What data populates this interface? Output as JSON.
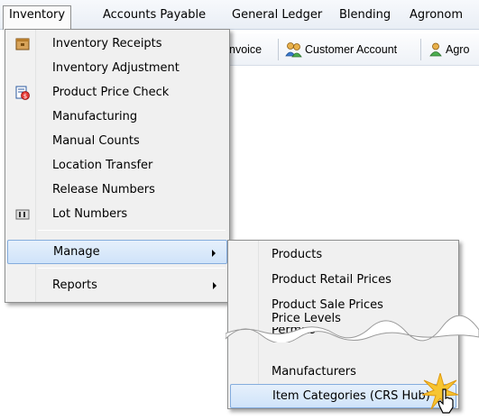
{
  "menubar": {
    "items": [
      {
        "label": "Inventory",
        "active": true
      },
      {
        "label": "Accounts Payable"
      },
      {
        "label": "General Ledger"
      },
      {
        "label": "Blending"
      },
      {
        "label": "Agronom"
      }
    ]
  },
  "toolbar": {
    "items": [
      {
        "label": "nvoice"
      },
      {
        "label": "Customer Account",
        "icon": "customers-icon"
      },
      {
        "label": "Agro",
        "icon": "person-icon"
      }
    ]
  },
  "menu": {
    "items": [
      {
        "label": "Inventory Receipts",
        "icon": "box-icon"
      },
      {
        "label": "Inventory Adjustment"
      },
      {
        "label": "Product Price Check",
        "icon": "price-check-icon"
      },
      {
        "label": "Manufacturing"
      },
      {
        "label": "Manual Counts"
      },
      {
        "label": "Location Transfer"
      },
      {
        "label": "Release Numbers"
      },
      {
        "label": "Lot Numbers",
        "icon": "lot-icon"
      },
      {
        "label": "Manage",
        "submenu": true,
        "highlighted": true
      },
      {
        "label": "Reports",
        "submenu": true
      }
    ]
  },
  "submenu": {
    "items": [
      {
        "label": "Products"
      },
      {
        "label": "Product Retail Prices"
      },
      {
        "label": "Product Sale Prices"
      },
      {
        "label": "Price Levels"
      },
      {
        "label": "Permits"
      },
      {
        "label": "Manufacturers"
      },
      {
        "label": "Item Categories (CRS Hub)",
        "highlighted": true
      }
    ]
  },
  "colors": {
    "highlight_border": "#84acdd",
    "highlight_fill": "#cfe3fa",
    "menu_bg": "#f0f0f0",
    "starburst": "#f7c531"
  }
}
